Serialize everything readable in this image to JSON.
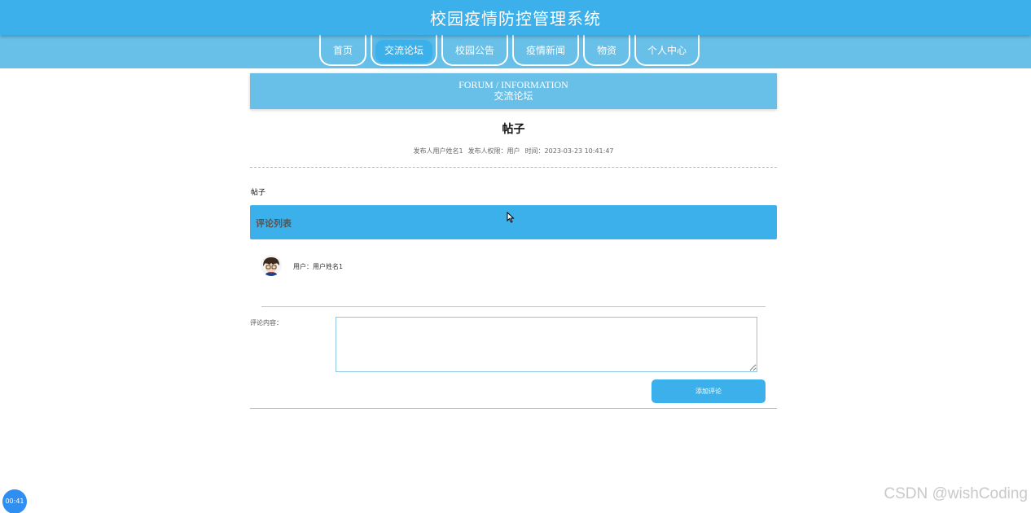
{
  "header": {
    "title": "校园疫情防控管理系统"
  },
  "nav": {
    "items": [
      {
        "label": "首页"
      },
      {
        "label": "交流论坛"
      },
      {
        "label": "校园公告"
      },
      {
        "label": "疫情新闻"
      },
      {
        "label": "物资"
      },
      {
        "label": "个人中心"
      }
    ],
    "active_index": 1
  },
  "banner": {
    "en": "FORUM / INFORMATION",
    "cn": "交流论坛"
  },
  "post": {
    "title": "帖子",
    "author": "发布人用户姓名1",
    "role": "发布人权限：用户",
    "time": "时间：2023-03-23 10:41:47",
    "content": "帖子"
  },
  "comments": {
    "header_label": "评论列表",
    "items": [
      {
        "user": "用户：用户姓名1"
      }
    ]
  },
  "comment_form": {
    "label": "评论内容：",
    "value": "",
    "submit_label": "添加评论"
  },
  "overlay": {
    "timer": "00:41",
    "watermark": "CSDN @wishCoding"
  },
  "colors": {
    "primary": "#3bb0ea",
    "nav_background": "#68c0e8"
  },
  "icons": {
    "avatar": "cartoon-avatar-icon",
    "cursor": "mouse-cursor-icon"
  }
}
